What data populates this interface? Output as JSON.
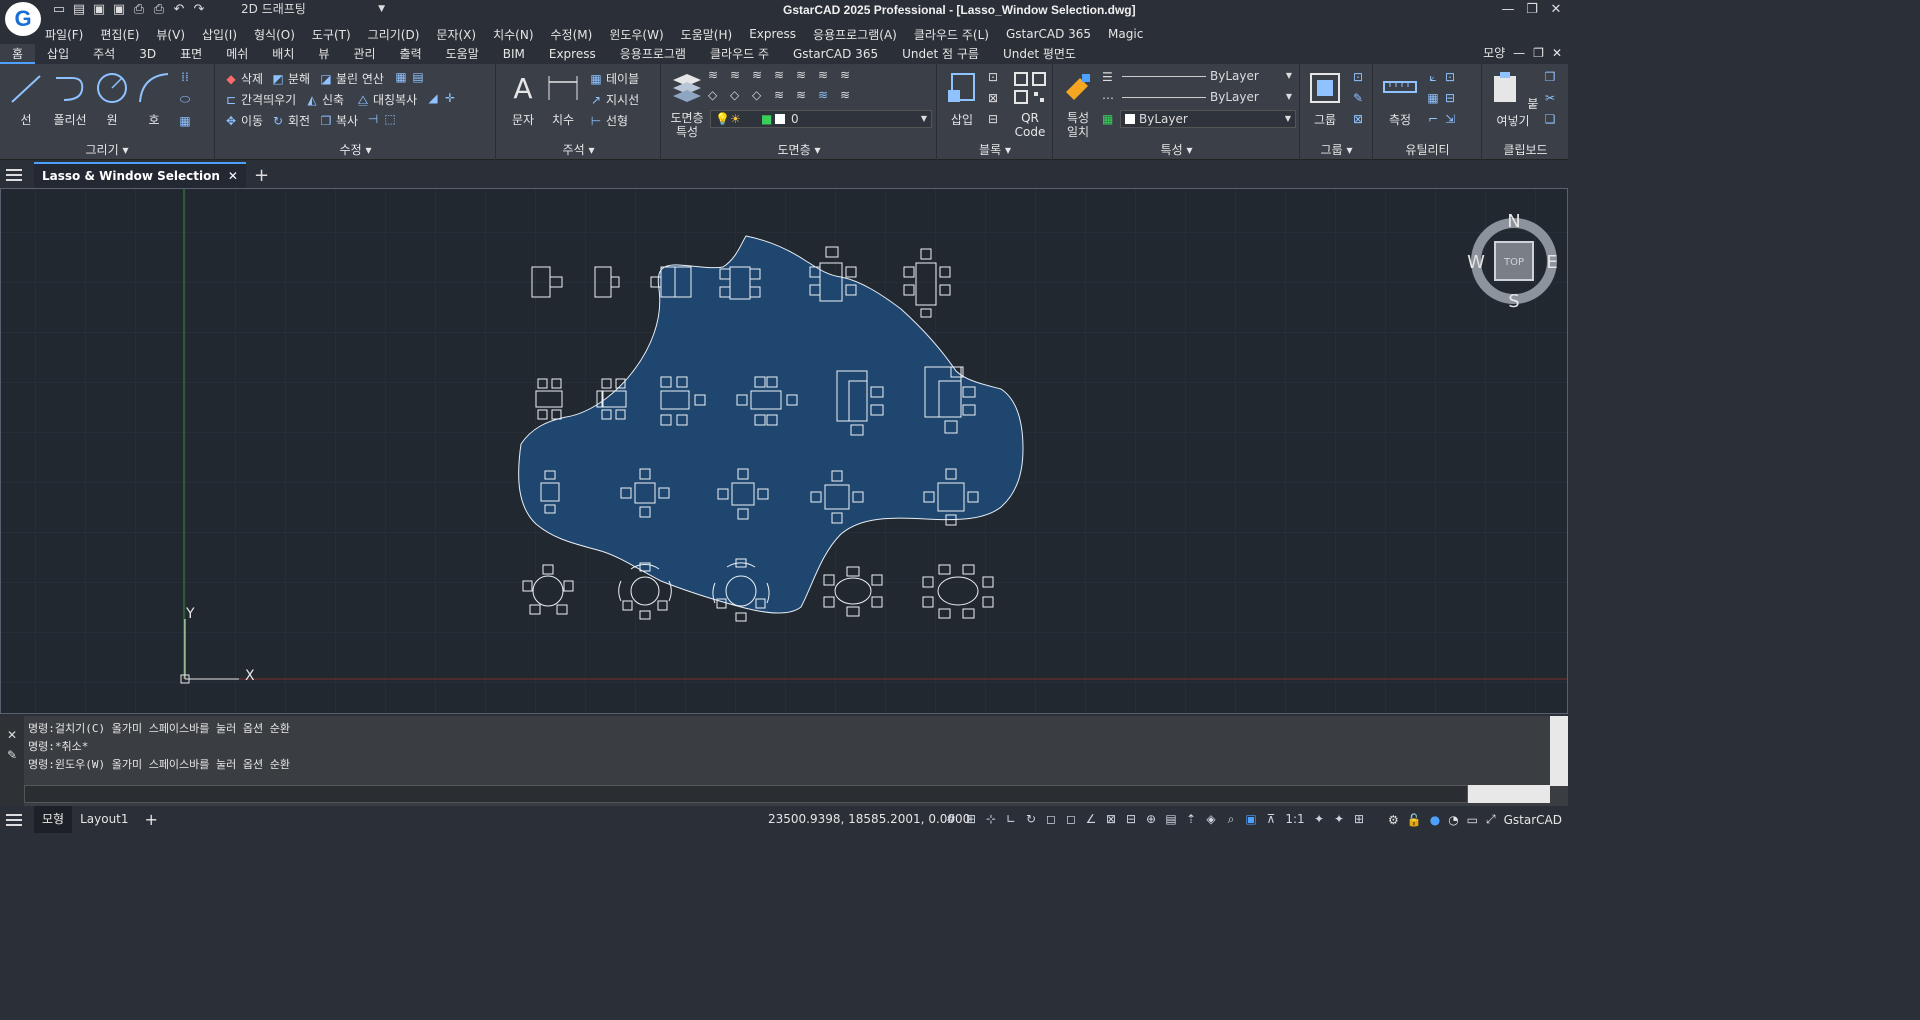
{
  "title": {
    "app": "GstarCAD 2025 Professional - [Lasso_Window Selection.dwg]",
    "workspace": "2D 드래프팅"
  },
  "menu": [
    "파일(F)",
    "편집(E)",
    "뷰(V)",
    "삽입(I)",
    "형식(O)",
    "도구(T)",
    "그리기(D)",
    "문자(X)",
    "치수(N)",
    "수정(M)",
    "윈도우(W)",
    "도움말(H)",
    "Express",
    "응용프로그램(A)",
    "클라우드 주(L)",
    "GstarCAD 365",
    "Magic"
  ],
  "ribbon_tabs": [
    "홈",
    "삽입",
    "주석",
    "3D",
    "표면",
    "메쉬",
    "배치",
    "뷰",
    "관리",
    "출력",
    "도움말",
    "BIM",
    "Express",
    "응용프로그램",
    "클라우드 주",
    "GstarCAD 365",
    "Undet 점 구름",
    "Undet 평면도"
  ],
  "ribbon_right": "모양",
  "panels": {
    "draw": {
      "label": "그리기",
      "line": "선",
      "polyline": "폴리선",
      "circle": "원",
      "arc": "호"
    },
    "modify": {
      "label": "수정",
      "erase": "삭제",
      "explode": "분해",
      "boolean": "불린 연산",
      "offset": "간격띄우기",
      "stretch": "신축",
      "mirror": "대칭복사",
      "move": "이동",
      "rotate": "회전",
      "copy": "복사"
    },
    "annotation": {
      "label": "주석",
      "text": "문자",
      "dim": "치수",
      "table": "테이블",
      "leader": "지시선",
      "linear": "선형"
    },
    "layers": {
      "label": "도면층",
      "props_line1": "도면층",
      "props_line2": "특성",
      "current": "0"
    },
    "block": {
      "label": "블록",
      "insert": "삽입",
      "qr_line1": "QR",
      "qr_line2": "Code"
    },
    "properties": {
      "label": "특성",
      "match_line1": "특성",
      "match_line2": "일치",
      "linetype": "ByLayer",
      "lineweight": "ByLayer",
      "color": "ByLayer"
    },
    "group": {
      "label": "그룹",
      "group": "그룹"
    },
    "utility": {
      "label": "유틸리티",
      "measure": "측정"
    },
    "clipboard": {
      "label": "클립보드",
      "paste": "붙여넣기"
    }
  },
  "doc_tab": "Lasso & Window Selection",
  "compass": {
    "n": "N",
    "s": "S",
    "e": "E",
    "w": "W",
    "top": "TOP"
  },
  "ucs": {
    "x": "X",
    "y": "Y"
  },
  "command_lines": [
    "명령:걸치기(C) 올가미  스페이스바를 눌러 옵션 순환",
    "명령:*취소*",
    "명령:윈도우(W) 올가미  스페이스바를 눌러 옵션 순환"
  ],
  "status": {
    "model_tab": "모형",
    "layout_tab": "Layout1",
    "coords": "23500.9398, 18585.2001, 0.0000",
    "scale": "1:1",
    "brand": "GstarCAD"
  },
  "colors": {
    "selection_fill": "#1f4a78",
    "canvas_bg": "#212830",
    "accent": "#4ea1ff"
  }
}
